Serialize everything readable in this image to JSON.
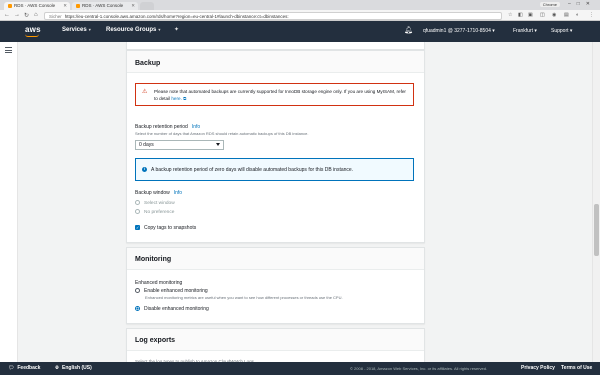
{
  "browser": {
    "tabs": [
      {
        "title": "RDS · AWS Console",
        "active": true
      },
      {
        "title": "RDS · AWS Console",
        "active": false
      }
    ],
    "user_chip": "Chrome",
    "security_label": "Sicher",
    "url": "https://eu-central-1.console.aws.amazon.com/rds/home?region=eu-central-1#launch-dbinstance:ct=dbinstances:"
  },
  "aws_nav": {
    "logo": "aws",
    "services": "Services",
    "resource_groups": "Resource Groups",
    "account": "qfuadmin1 @ 3277-1710-8504",
    "region": "Frankfurt",
    "support": "Support"
  },
  "backup": {
    "title": "Backup",
    "warning_text": "Please note that automated backups are currently supported for InnoDB storage engine only. If you are using MyISAM, refer to detail ",
    "warning_link": "here.",
    "retention_label": "Backup retention period",
    "info": "Info",
    "retention_desc": "Select the number of days that Amazon RDS should retain automatic backups of this DB instance.",
    "retention_value": "0 days",
    "zero_days_info": "A backup retention period of zero days will disable automated backups for this DB instance.",
    "window_label": "Backup window",
    "window_info": "Info",
    "select_window": "Select window",
    "no_preference": "No preference",
    "copy_tags": "Copy tags to snapshots"
  },
  "monitoring": {
    "title": "Monitoring",
    "enhanced_label": "Enhanced monitoring",
    "enable_label": "Enable enhanced monitoring",
    "enable_desc": "Enhanced monitoring metrics are useful when you want to see how different processes or threads use the CPU.",
    "disable_label": "Disable enhanced monitoring",
    "selected": "disable"
  },
  "log_exports": {
    "title": "Log exports",
    "desc": "Select the log types to publish to Amazon CloudWatch Logs"
  },
  "footer": {
    "feedback": "Feedback",
    "language": "English (US)",
    "copyright": "© 2008 - 2018, Amazon Web Services, Inc. or its affiliates. All rights reserved.",
    "privacy": "Privacy Policy",
    "terms": "Terms of Use"
  },
  "colors": {
    "aws_nav": "#232f3e",
    "aws_orange": "#ff9900",
    "link": "#0073bb",
    "warning": "#d13212"
  }
}
